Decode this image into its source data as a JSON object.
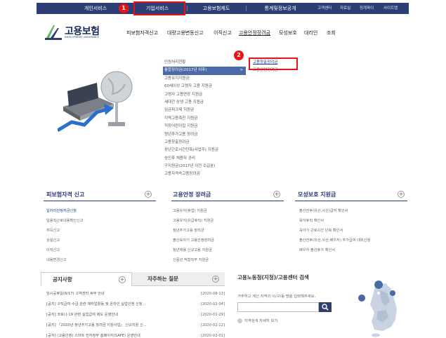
{
  "topnav": {
    "items": [
      "개인서비스",
      "기업서비스",
      "고용보험제도",
      "통계및정보공개"
    ],
    "util": [
      "고객센터",
      "자료실",
      "징계파이",
      "사이트맵"
    ]
  },
  "badges": [
    "1",
    "2"
  ],
  "logo": {
    "title": "고용보험",
    "subtitle": "EMPLOYMENT INSURANCE"
  },
  "mainmenu": [
    "피보험자격신고",
    "대량고용변동신고",
    "이직신고",
    "고용안정장려금",
    "모성보호",
    "대리인",
    "조회"
  ],
  "submenu": [
    "민원처리현황",
    "통합장려금(2017년 이후)",
    "고용유지지원금",
    "60세이상 고령자 고용 지원금",
    "고령자 고용연장 지원금",
    "세대간 상생 고용 지원금",
    "임금피크제 지원금",
    "지역고용촉진 지원금",
    "직장어린이집 지원금",
    "청년추가고용 장려금",
    "고용창출장려금",
    "장년근로시간단축(사업주) 지원금",
    "승인후 채용자 관리",
    "구지원금(2017년 이전 소급분)",
    "고용자격속고용장려금"
  ],
  "submenu_arrow": ">",
  "subsub": [
    "고용창출장려금",
    "고용안정장려금"
  ],
  "columns": [
    {
      "title": "피보험자격 신고",
      "items": [
        "일자리안정자금신청",
        "일용직근로내용확인신고",
        "취득신고",
        "상실신고",
        "이직신고",
        "내용변경신고"
      ]
    },
    {
      "title": "고용안정 장려금",
      "items": [
        "고용유지(휴업) 지원금",
        "고용유지(유급휴직) 지원금",
        "청년추가고용 장려금",
        "출산육아기 고용안정장려금",
        "청년채용 신규고용 지원금",
        "신중년 적합직무 지원금"
      ]
    },
    {
      "title": "모성보호 지원금",
      "items": [
        "출산전후(유산,사산)급여 확인서",
        "육아휴직 확인서",
        "육아기 근로시간 단축 확인서",
        "출산전후(유산,사산,배우자) 추가급여 대위신청",
        "배우자 출산휴가 확인서"
      ]
    }
  ],
  "plus_symbol": "+",
  "tabs": [
    "공지사항",
    "자주하는 질문"
  ],
  "notices": [
    {
      "text": "임시공휴일(8/17) 고객센터 휴무 안내",
      "date": "[2020-08-13]"
    },
    {
      "text": "[공지] 구직급여 수급 관련 재취업활동 및 온라인 실업인정 신청...",
      "date": "[2020-02-04]"
    },
    {
      "text": "[공지] 코로나-19 관련 실업급여 제도 운영안내",
      "date": "[2020-01-29]"
    },
    {
      "text": "[공지] 「2020년 청년추가고용 장려금 지원사업」 신규지원 신...",
      "date": "[2020-02-12]"
    },
    {
      "text": "[공지] (고용안정) 스마트 전자정부 홈페이지(SAFE) 운영안내",
      "date": "[2020-02-01]"
    }
  ],
  "search": {
    "title": "고용노동청(지청)/고용센터 검색",
    "desc": "거주하고 계신 지역의 시/구/동 명을 입력해주세요.",
    "placeholder": "",
    "button_icon": "search-icon",
    "link": "지역검색 자세히 보기"
  },
  "colors": {
    "nav_dark": "#2c3e73",
    "accent_blue": "#2a3b7a",
    "highlight": "#4c6aa8",
    "red_annotation": "#e11111"
  }
}
